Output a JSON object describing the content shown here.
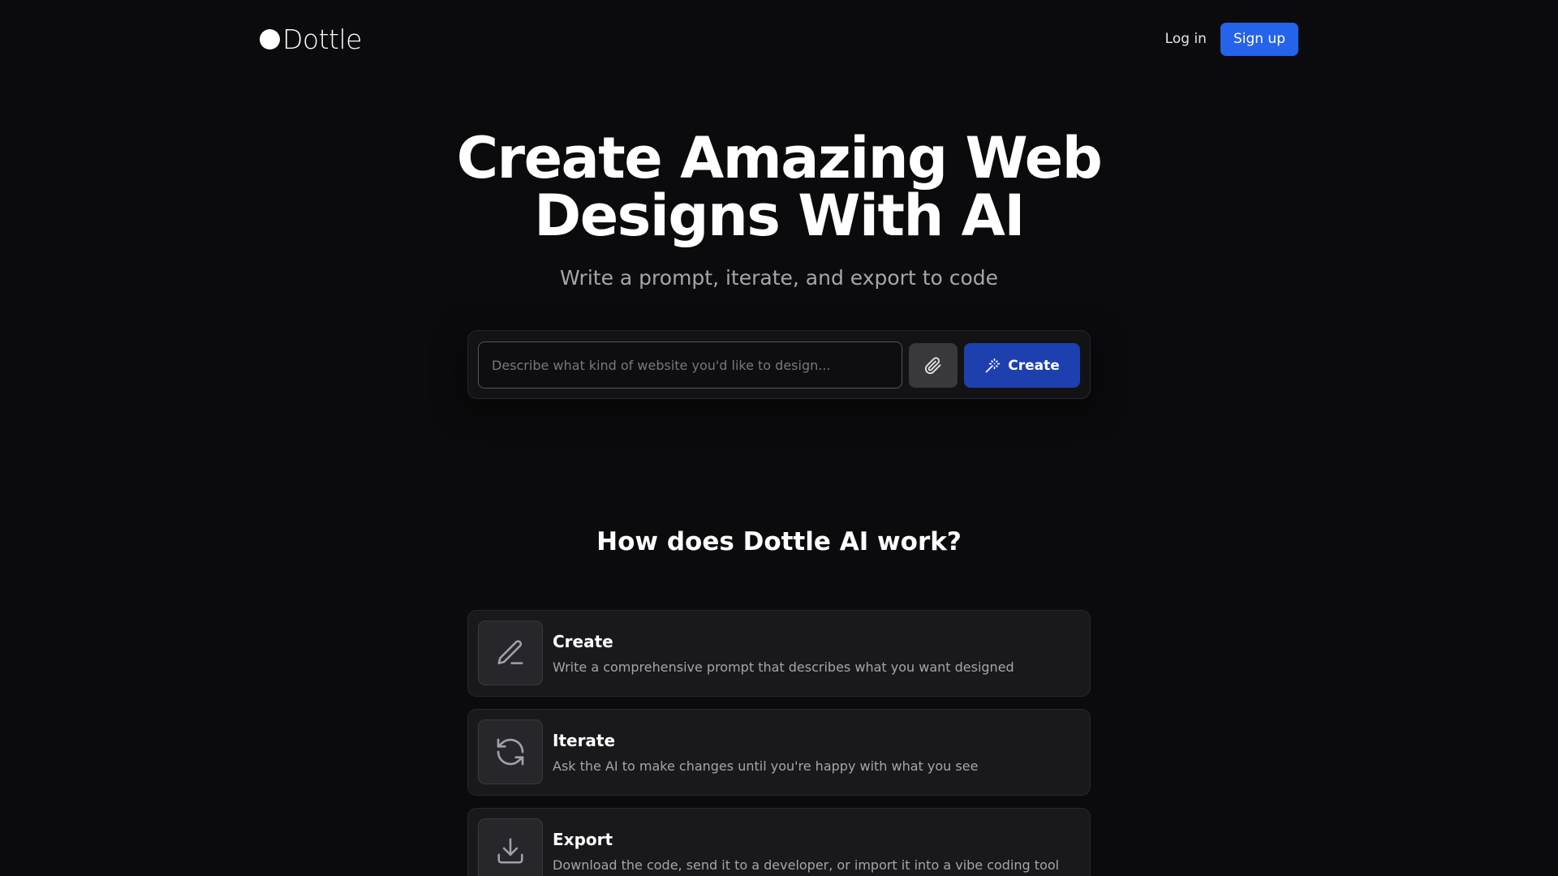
{
  "brand": {
    "name": "Dottle"
  },
  "nav": {
    "login_label": "Log in",
    "signup_label": "Sign up"
  },
  "hero": {
    "title_line1": "Create Amazing Web",
    "title_line2": "Designs With AI",
    "subtitle": "Write a prompt, iterate, and export to code"
  },
  "prompt": {
    "placeholder": "Describe what kind of website you'd like to design...",
    "value": "",
    "attach_icon": "paperclip-icon",
    "create_icon": "magic-wand-icon",
    "create_label": "Create"
  },
  "how": {
    "title": "How does Dottle AI work?",
    "steps": [
      {
        "icon": "pencil-icon",
        "title": "Create",
        "description": "Write a comprehensive prompt that describes what you want designed"
      },
      {
        "icon": "refresh-icon",
        "title": "Iterate",
        "description": "Ask the AI to make changes until you're happy with what you see"
      },
      {
        "icon": "download-icon",
        "title": "Export",
        "description": "Download the code, send it to a developer, or import it into a vibe coding tool"
      }
    ]
  },
  "colors": {
    "background": "#0b0b0d",
    "accent": "#2563eb",
    "create_button": "#1e40af",
    "card": "#19191c",
    "muted_text": "#a4a5ac"
  }
}
